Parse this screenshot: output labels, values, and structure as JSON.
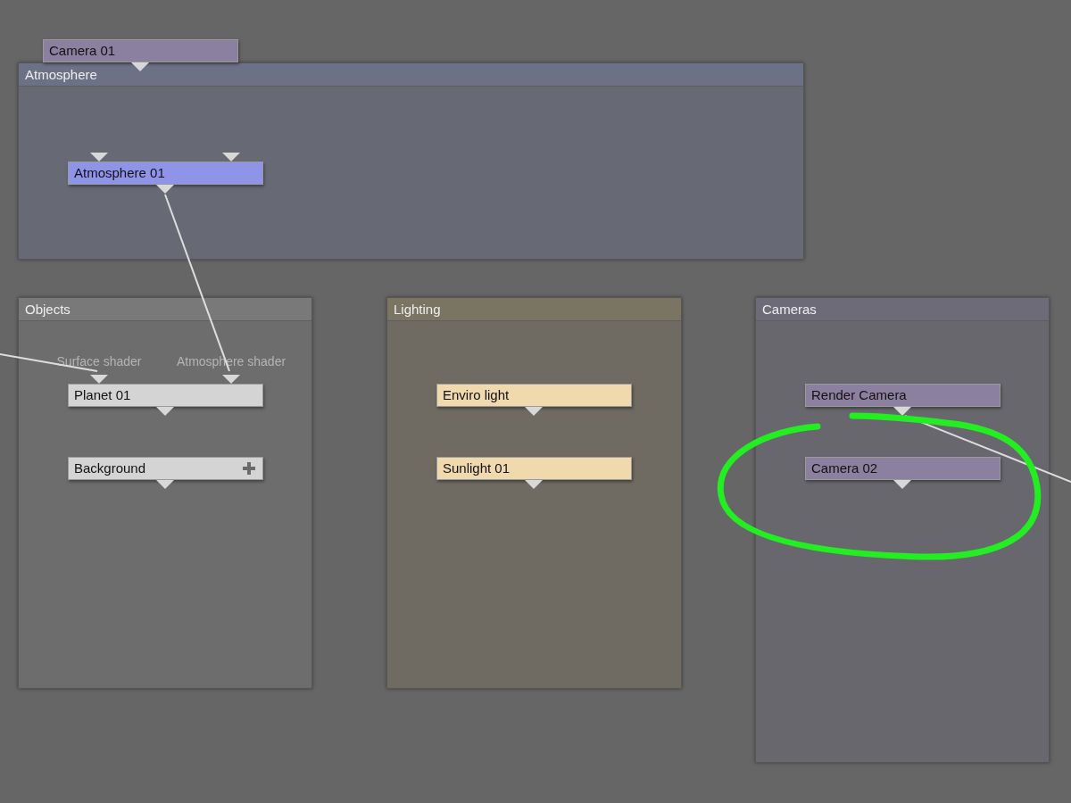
{
  "groups": [
    {
      "title": "Atmosphere",
      "kind": "atmosphere"
    },
    {
      "title": "Objects",
      "kind": "objects"
    },
    {
      "title": "Lighting",
      "kind": "lighting"
    },
    {
      "title": "Cameras",
      "kind": "cameras"
    }
  ],
  "nodes": [
    {
      "label": "Camera 01",
      "kind": "camera",
      "add_button": false
    },
    {
      "label": "Atmosphere 01",
      "kind": "atmosphere",
      "add_button": false
    },
    {
      "label": "Planet 01",
      "kind": "object",
      "add_button": false,
      "input_labels": [
        "Surface shader",
        "Atmosphere shader"
      ]
    },
    {
      "label": "Background",
      "kind": "object",
      "add_button": true
    },
    {
      "label": "Enviro light",
      "kind": "light",
      "add_button": false
    },
    {
      "label": "Sunlight 01",
      "kind": "light",
      "add_button": false
    },
    {
      "label": "Render Camera",
      "kind": "camera",
      "add_button": false
    },
    {
      "label": "Camera 02",
      "kind": "camera",
      "add_button": false
    }
  ]
}
